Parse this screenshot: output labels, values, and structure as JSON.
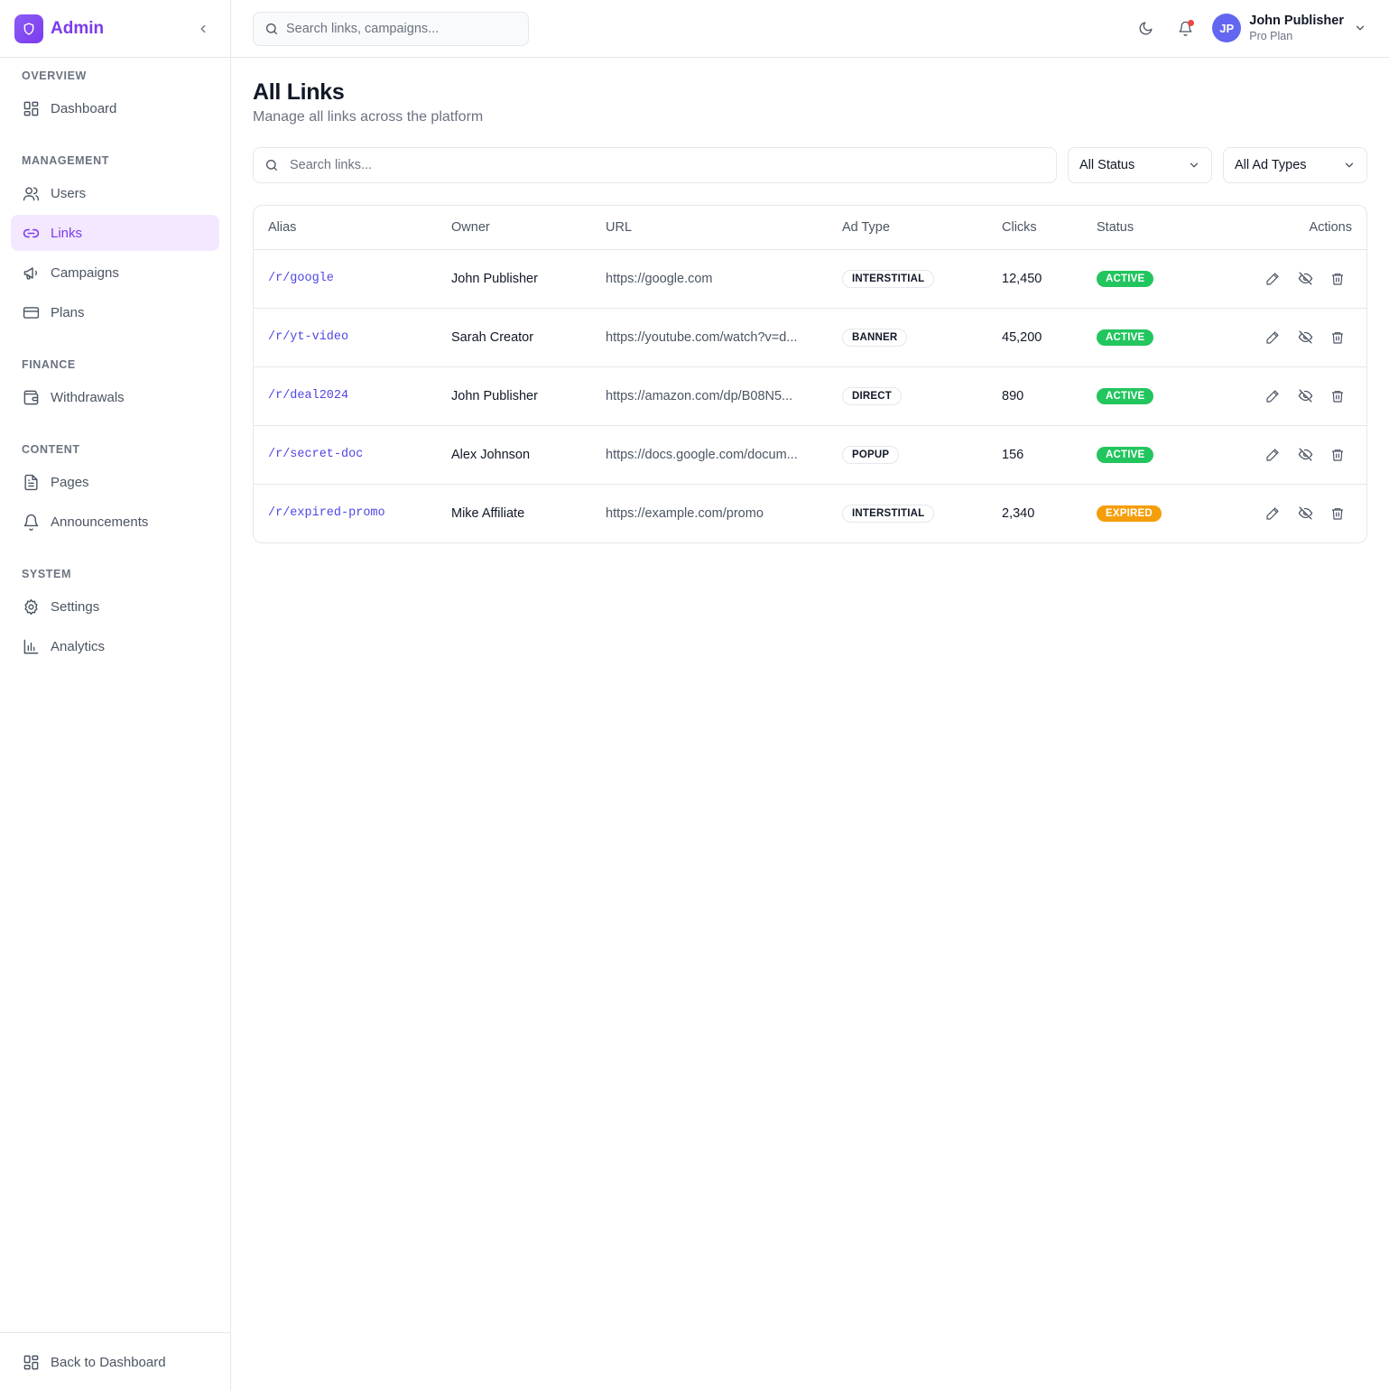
{
  "brand": {
    "name": "Admin"
  },
  "sidebar": {
    "sections": [
      {
        "label": "OVERVIEW",
        "items": [
          {
            "label": "Dashboard",
            "icon": "dashboard-grid-icon"
          }
        ]
      },
      {
        "label": "MANAGEMENT",
        "items": [
          {
            "label": "Users",
            "icon": "users-icon"
          },
          {
            "label": "Links",
            "icon": "link-icon",
            "active": true
          },
          {
            "label": "Campaigns",
            "icon": "megaphone-icon"
          },
          {
            "label": "Plans",
            "icon": "credit-card-icon"
          }
        ]
      },
      {
        "label": "FINANCE",
        "items": [
          {
            "label": "Withdrawals",
            "icon": "wallet-icon"
          }
        ]
      },
      {
        "label": "CONTENT",
        "items": [
          {
            "label": "Pages",
            "icon": "file-text-icon"
          },
          {
            "label": "Announcements",
            "icon": "bell-icon"
          }
        ]
      },
      {
        "label": "SYSTEM",
        "items": [
          {
            "label": "Settings",
            "icon": "gear-icon"
          },
          {
            "label": "Analytics",
            "icon": "bar-chart-icon"
          }
        ]
      }
    ],
    "footer": {
      "label": "Back to Dashboard",
      "icon": "dashboard-grid-icon"
    }
  },
  "topbar": {
    "search_placeholder": "Search links, campaigns...",
    "user": {
      "initials": "JP",
      "name": "John Publisher",
      "plan": "Pro Plan"
    }
  },
  "page": {
    "title": "All Links",
    "subtitle": "Manage all links across the platform",
    "search_placeholder": "Search links...",
    "status_filter": "All Status",
    "adtype_filter": "All Ad Types"
  },
  "table": {
    "headers": {
      "alias": "Alias",
      "owner": "Owner",
      "url": "URL",
      "ad_type": "Ad Type",
      "clicks": "Clicks",
      "status": "Status",
      "actions": "Actions"
    },
    "rows": [
      {
        "alias": "/r/google",
        "owner": "John Publisher",
        "url": "https://google.com",
        "ad_type": "INTERSTITIAL",
        "clicks": "12,450",
        "status": "ACTIVE"
      },
      {
        "alias": "/r/yt-video",
        "owner": "Sarah Creator",
        "url": "https://youtube.com/watch?v=d...",
        "ad_type": "BANNER",
        "clicks": "45,200",
        "status": "ACTIVE"
      },
      {
        "alias": "/r/deal2024",
        "owner": "John Publisher",
        "url": "https://amazon.com/dp/B08N5...",
        "ad_type": "DIRECT",
        "clicks": "890",
        "status": "ACTIVE"
      },
      {
        "alias": "/r/secret-doc",
        "owner": "Alex Johnson",
        "url": "https://docs.google.com/docum...",
        "ad_type": "POPUP",
        "clicks": "156",
        "status": "ACTIVE"
      },
      {
        "alias": "/r/expired-promo",
        "owner": "Mike Affiliate",
        "url": "https://example.com/promo",
        "ad_type": "INTERSTITIAL",
        "clicks": "2,340",
        "status": "EXPIRED"
      }
    ]
  },
  "colors": {
    "accent": "#7c3aed",
    "active": "#22c55e",
    "expired": "#f59e0b",
    "alias_link": "#4f46e5"
  }
}
